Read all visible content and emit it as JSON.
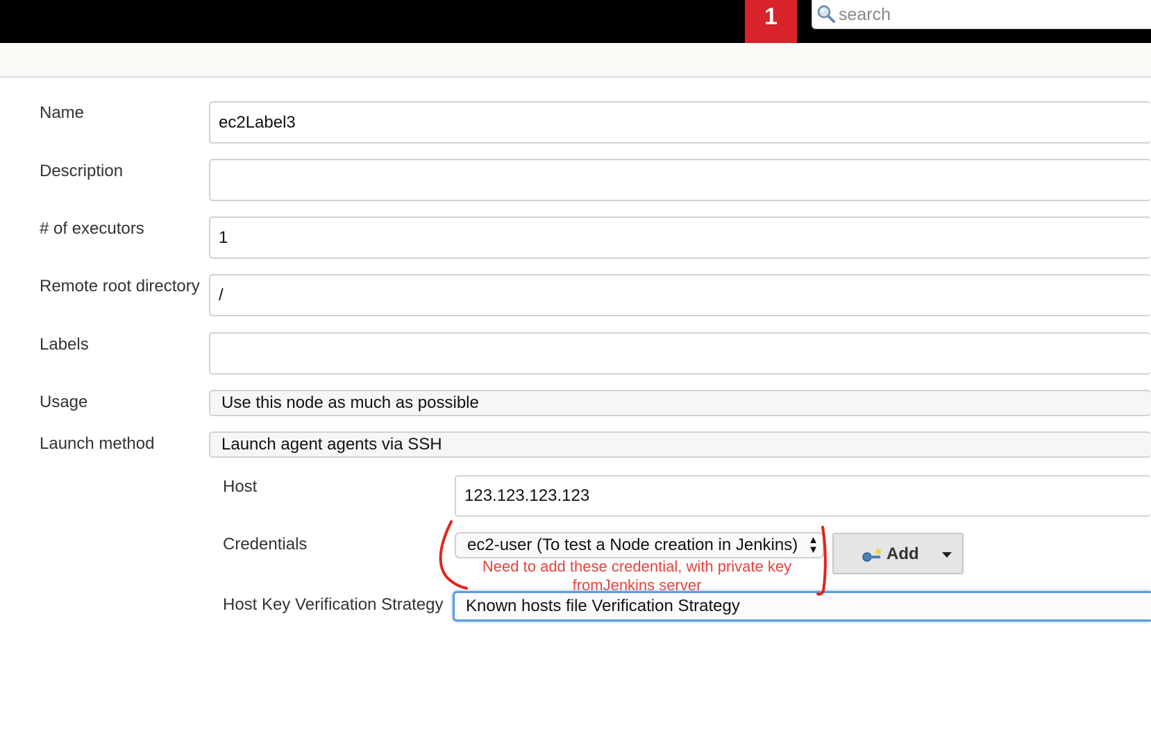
{
  "header": {
    "notification_count": "1",
    "search_placeholder": "search"
  },
  "form": {
    "name_label": "Name",
    "name_value": "ec2Label3",
    "description_label": "Description",
    "description_value": "",
    "executors_label": "# of executors",
    "executors_value": "1",
    "remote_root_label": "Remote root directory",
    "remote_root_value": "/",
    "labels_label": "Labels",
    "labels_value": "",
    "usage_label": "Usage",
    "usage_value": "Use this node as much as possible",
    "launch_label": "Launch method",
    "launch_value": "Launch agent agents via SSH",
    "host_label": "Host",
    "host_value": "123.123.123.123",
    "credentials_label": "Credentials",
    "credentials_value": "ec2-user (To test a Node creation in Jenkins)",
    "add_button_label": "Add",
    "hkv_label": "Host Key Verification Strategy",
    "hkv_value": "Known hosts file Verification Strategy"
  },
  "annotation": {
    "line1": "Need to add these credential, with private key",
    "line2": "fromJenkins server",
    "color": "#e8413c"
  },
  "colors": {
    "badge": "#d8232a",
    "topbar": "#000000",
    "focus": "#5b9ee6"
  },
  "icons": {
    "search": "magnifier-icon",
    "add": "key-icon"
  }
}
